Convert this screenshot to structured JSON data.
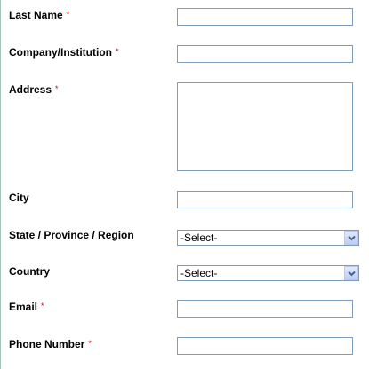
{
  "form": {
    "required_marker": "*",
    "fields": {
      "last_name": {
        "label": "Last Name",
        "value": ""
      },
      "company": {
        "label": "Company/Institution",
        "value": ""
      },
      "address": {
        "label": "Address",
        "value": ""
      },
      "city": {
        "label": "City",
        "value": ""
      },
      "state": {
        "label": "State / Province / Region",
        "selected": "-Select-"
      },
      "country": {
        "label": "Country",
        "selected": "-Select-"
      },
      "email": {
        "label": "Email",
        "value": ""
      },
      "phone": {
        "label": "Phone Number",
        "value": ""
      }
    }
  },
  "icons": {
    "dropdown": "chevron-down-icon",
    "required": "asterisk"
  },
  "colors": {
    "required": "#cc0000",
    "field_border": "#7f9db9",
    "dropdown_button": "#c4d3f8"
  }
}
